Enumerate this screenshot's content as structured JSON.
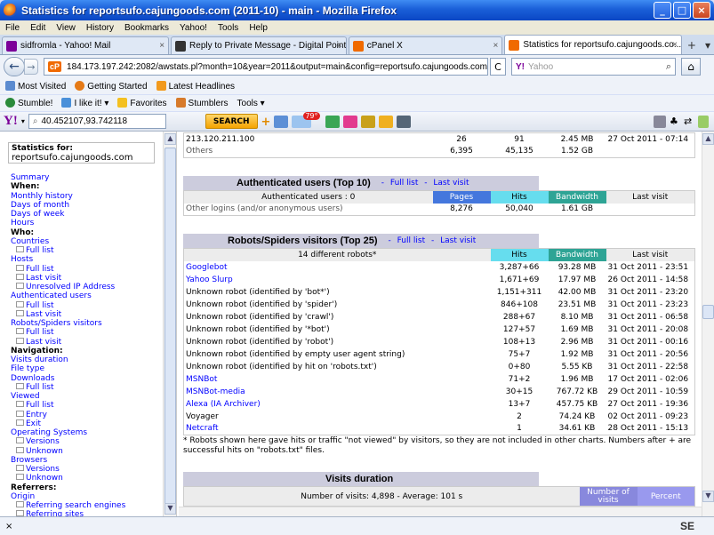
{
  "window": {
    "title": "Statistics for reportsufo.cajungoods.com (2011-10) - main - Mozilla Firefox"
  },
  "menu": [
    "File",
    "Edit",
    "View",
    "History",
    "Bookmarks",
    "Yahoo!",
    "Tools",
    "Help"
  ],
  "tabs": [
    {
      "label": "sidfromla - Yahoo! Mail",
      "icon": "mail-icon",
      "active": false
    },
    {
      "label": "Reply to Private Message - Digital Point ...",
      "icon": "digitalpoint-icon",
      "active": false
    },
    {
      "label": "cPanel X",
      "icon": "cpanel-icon",
      "active": false
    },
    {
      "label": "Statistics for reportsufo.cajungoods.co...",
      "icon": "cpanel-icon",
      "active": true
    }
  ],
  "nav": {
    "url_badge": "cP",
    "url": "184.173.197.242:2082/awstats.pl?month=10&year=2011&output=main&config=reportsufo.cajungoods.com&lang=en",
    "search_placeholder": "Yahoo",
    "search_logo": "Y!"
  },
  "bookmarks": [
    "Most Visited",
    "Getting Started",
    "Latest Headlines"
  ],
  "stumble_bar": [
    "Stumble!",
    "I like it!",
    "Favorites",
    "Stumblers",
    "Tools"
  ],
  "yahoo_toolbar": {
    "logo": "Y!",
    "search_value": "40.452107,93.742118",
    "search_button": "SEARCH",
    "weather_badge": "79°"
  },
  "left": {
    "stat_label": "Statistics for:",
    "stat_site": "reportsufo.cajungoods.com",
    "nav": [
      {
        "t": "it",
        "label": "Summary"
      },
      {
        "t": "hd",
        "label": "When:"
      },
      {
        "t": "it",
        "label": "Monthly history"
      },
      {
        "t": "it",
        "label": "Days of month"
      },
      {
        "t": "it",
        "label": "Days of week"
      },
      {
        "t": "it",
        "label": "Hours"
      },
      {
        "t": "hd",
        "label": "Who:"
      },
      {
        "t": "it",
        "label": "Countries"
      },
      {
        "t": "sub",
        "label": "Full list"
      },
      {
        "t": "it",
        "label": "Hosts"
      },
      {
        "t": "sub",
        "label": "Full list"
      },
      {
        "t": "sub",
        "label": "Last visit"
      },
      {
        "t": "sub",
        "label": "Unresolved IP Address"
      },
      {
        "t": "it",
        "label": "Authenticated users"
      },
      {
        "t": "sub",
        "label": "Full list"
      },
      {
        "t": "sub",
        "label": "Last visit"
      },
      {
        "t": "it",
        "label": "Robots/Spiders visitors"
      },
      {
        "t": "sub",
        "label": "Full list"
      },
      {
        "t": "sub",
        "label": "Last visit"
      },
      {
        "t": "hd",
        "label": "Navigation:"
      },
      {
        "t": "it",
        "label": "Visits duration"
      },
      {
        "t": "it",
        "label": "File type"
      },
      {
        "t": "it",
        "label": "Downloads"
      },
      {
        "t": "sub",
        "label": "Full list"
      },
      {
        "t": "it",
        "label": "Viewed"
      },
      {
        "t": "sub",
        "label": "Full list"
      },
      {
        "t": "sub",
        "label": "Entry"
      },
      {
        "t": "sub",
        "label": "Exit"
      },
      {
        "t": "it",
        "label": "Operating Systems"
      },
      {
        "t": "sub",
        "label": "Versions"
      },
      {
        "t": "sub",
        "label": "Unknown"
      },
      {
        "t": "it",
        "label": "Browsers"
      },
      {
        "t": "sub",
        "label": "Versions"
      },
      {
        "t": "sub",
        "label": "Unknown"
      },
      {
        "t": "hd",
        "label": "Referrers:"
      },
      {
        "t": "it",
        "label": "Origin"
      },
      {
        "t": "sub",
        "label": "Referring search engines"
      },
      {
        "t": "sub",
        "label": "Referring sites"
      }
    ]
  },
  "hosts_tail": [
    {
      "host": "213.120.211.100",
      "pages": "26",
      "hits": "91",
      "bw": "2.45 MB",
      "last": "27 Oct 2011 - 07:14"
    },
    {
      "host": "Others",
      "pages": "6,395",
      "hits": "45,135",
      "bw": "1.52 GB",
      "last": ""
    }
  ],
  "auth": {
    "title": "Authenticated users (Top 10)",
    "link_full": "Full list",
    "link_last": "Last visit",
    "sep": "-",
    "count_label": "Authenticated users : 0",
    "cols": {
      "pages": "Pages",
      "hits": "Hits",
      "bw": "Bandwidth",
      "last": "Last visit"
    },
    "other": {
      "label": "Other logins (and/or anonymous users)",
      "pages": "8,276",
      "hits": "50,040",
      "bw": "1.61 GB"
    }
  },
  "robots": {
    "title": "Robots/Spiders visitors (Top 25)",
    "link_full": "Full list",
    "link_last": "Last visit",
    "sep": "-",
    "count_label": "14 different robots*",
    "cols": {
      "hits": "Hits",
      "bw": "Bandwidth",
      "last": "Last visit"
    },
    "rows": [
      {
        "name": "Googlebot",
        "link": true,
        "hits": "3,287+66",
        "bw": "93.28 MB",
        "last": "31 Oct 2011 - 23:51"
      },
      {
        "name": "Yahoo Slurp",
        "link": true,
        "hits": "1,671+69",
        "bw": "17.97 MB",
        "last": "26 Oct 2011 - 14:58"
      },
      {
        "name": "Unknown robot (identified by 'bot*')",
        "link": false,
        "hits": "1,151+311",
        "bw": "42.00 MB",
        "last": "31 Oct 2011 - 23:20"
      },
      {
        "name": "Unknown robot (identified by 'spider')",
        "link": false,
        "hits": "846+108",
        "bw": "23.51 MB",
        "last": "31 Oct 2011 - 23:23"
      },
      {
        "name": "Unknown robot (identified by 'crawl')",
        "link": false,
        "hits": "288+67",
        "bw": "8.10 MB",
        "last": "31 Oct 2011 - 06:58"
      },
      {
        "name": "Unknown robot (identified by '*bot')",
        "link": false,
        "hits": "127+57",
        "bw": "1.69 MB",
        "last": "31 Oct 2011 - 20:08"
      },
      {
        "name": "Unknown robot (identified by 'robot')",
        "link": false,
        "hits": "108+13",
        "bw": "2.96 MB",
        "last": "31 Oct 2011 - 00:16"
      },
      {
        "name": "Unknown robot (identified by empty user agent string)",
        "link": false,
        "hits": "75+7",
        "bw": "1.92 MB",
        "last": "31 Oct 2011 - 20:56"
      },
      {
        "name": "Unknown robot (identified by hit on 'robots.txt')",
        "link": false,
        "hits": "0+80",
        "bw": "5.55 KB",
        "last": "31 Oct 2011 - 22:58"
      },
      {
        "name": "MSNBot",
        "link": true,
        "hits": "71+2",
        "bw": "1.96 MB",
        "last": "17 Oct 2011 - 02:06"
      },
      {
        "name": "MSNBot-media",
        "link": true,
        "hits": "30+15",
        "bw": "767.72 KB",
        "last": "29 Oct 2011 - 10:59"
      },
      {
        "name": "Alexa (IA Archiver)",
        "link": true,
        "hits": "13+7",
        "bw": "457.75 KB",
        "last": "27 Oct 2011 - 19:36"
      },
      {
        "name": "Voyager",
        "link": false,
        "hits": "2",
        "bw": "74.24 KB",
        "last": "02 Oct 2011 - 09:23"
      },
      {
        "name": "Netcraft",
        "link": true,
        "hits": "1",
        "bw": "34.61 KB",
        "last": "28 Oct 2011 - 15:13"
      }
    ],
    "note": "* Robots shown here gave hits or traffic \"not viewed\" by visitors, so they are not included in other charts. Numbers after + are successful hits on \"robots.txt\" files."
  },
  "visits": {
    "title": "Visits duration",
    "summary": "Number of visits: 4,898 - Average: 101 s",
    "col_nv": "Number of visits",
    "col_pct": "Percent"
  },
  "status": {
    "left": "×",
    "right": "SE"
  }
}
